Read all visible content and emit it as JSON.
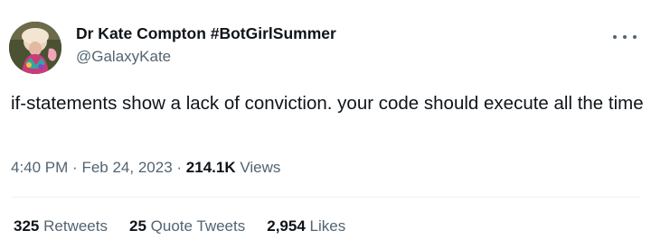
{
  "author": {
    "display_name": "Dr Kate Compton #BotGirlSummer",
    "handle": "@GalaxyKate"
  },
  "tweet": {
    "text": "if-statements show a lack of conviction. your code should execute all the time",
    "time": "4:40 PM",
    "date": "Feb 24, 2023",
    "separator": "·",
    "views_count": "214.1K",
    "views_label": "Views"
  },
  "stats": {
    "retweets_count": "325",
    "retweets_label": "Retweets",
    "quote_count": "25",
    "quote_label": "Quote Tweets",
    "likes_count": "2,954",
    "likes_label": "Likes"
  },
  "icons": {
    "more": "more-horizontal-icon",
    "avatar": "profile-photo"
  }
}
